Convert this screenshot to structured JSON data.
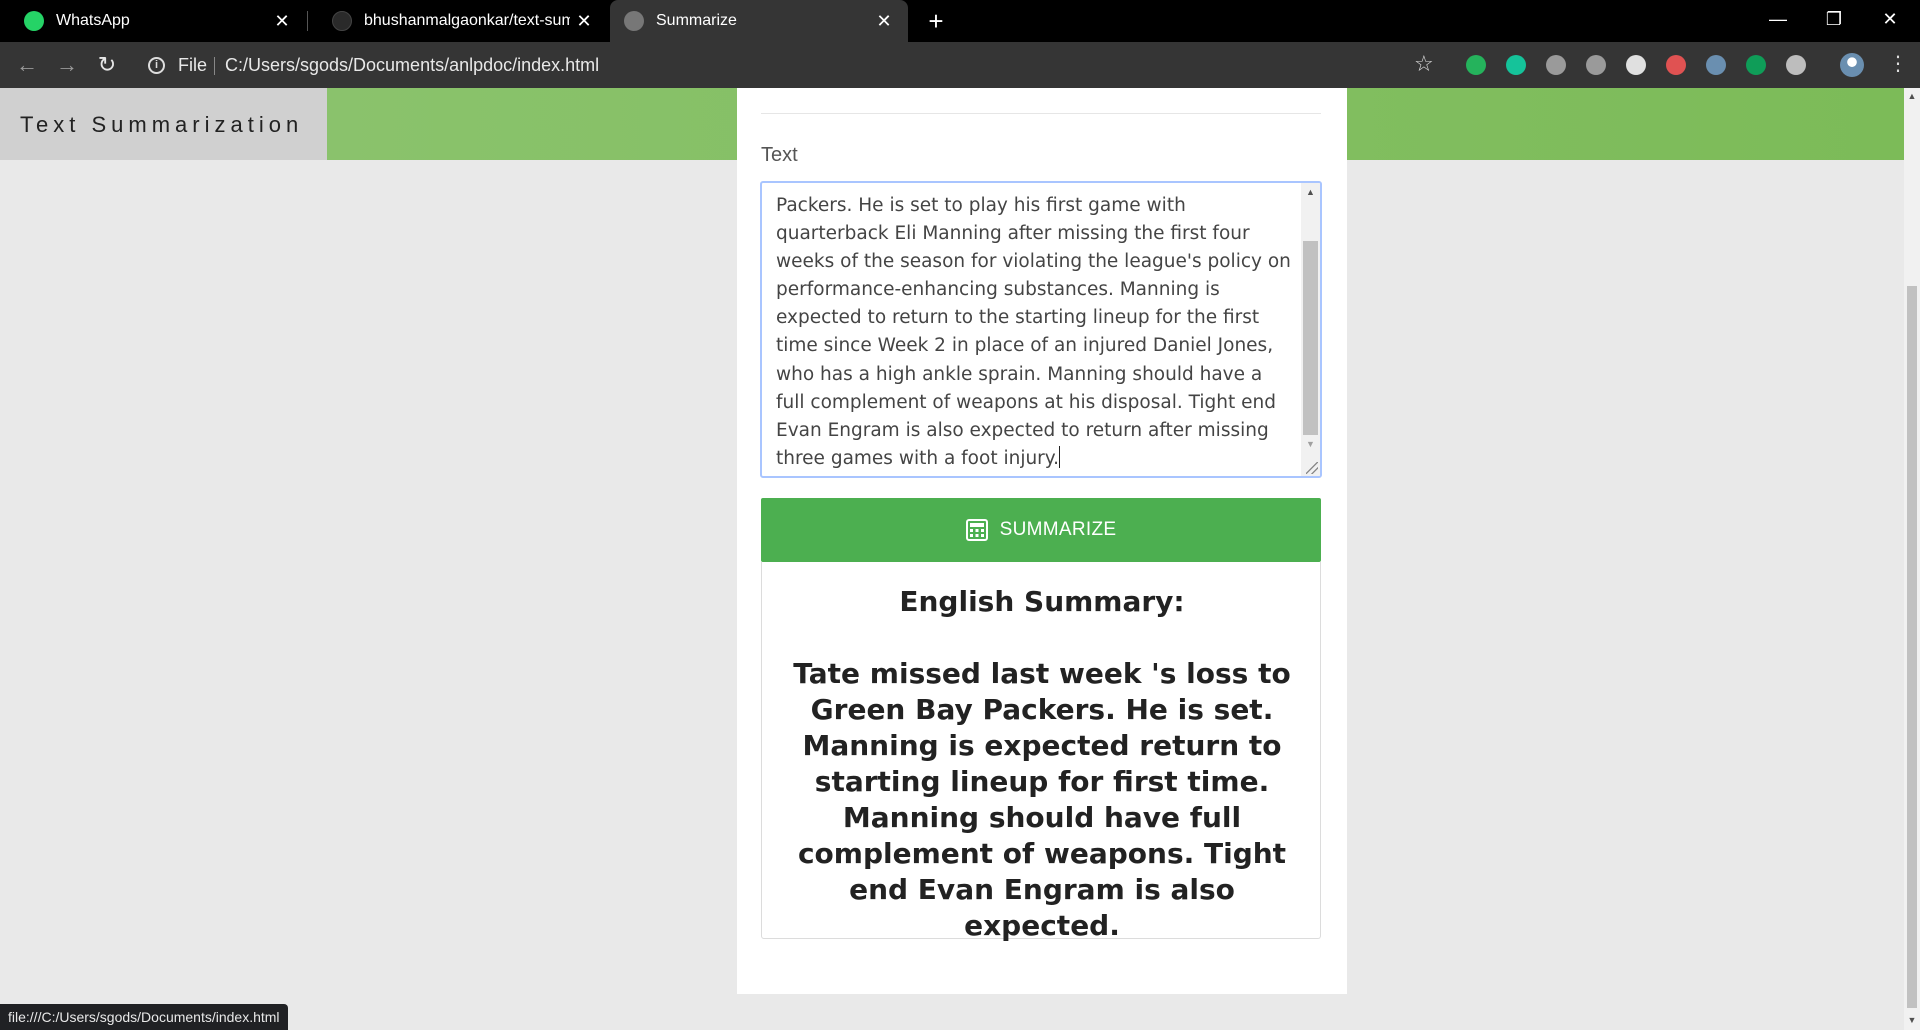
{
  "tabs": [
    {
      "title": "WhatsApp",
      "icon": "whatsapp-icon",
      "color": "#25d366"
    },
    {
      "title": "bhushanmalgaonkar/text-summa",
      "icon": "github-icon",
      "color": "#2a2a2a"
    },
    {
      "title": "Summarize",
      "icon": "globe-icon",
      "color": "#888888"
    }
  ],
  "address_bar": {
    "scheme_label": "File",
    "url": "C:/Users/sgods/Documents/anlpdoc/index.html"
  },
  "extensions": [
    {
      "name": "extension-green-icon",
      "color": "#25b35c"
    },
    {
      "name": "grammarly-icon",
      "color": "#15c39a"
    },
    {
      "name": "extension-p-icon",
      "color": "#9a9a9a"
    },
    {
      "name": "pdf-icon",
      "color": "#9a9a9a"
    },
    {
      "name": "extension-circle-icon",
      "color": "#e0e0e0"
    },
    {
      "name": "shield-extension-icon",
      "color": "#e05252"
    },
    {
      "name": "extension-window-icon",
      "color": "#6a8fb0"
    },
    {
      "name": "extension-chat-icon",
      "color": "#0f9d58"
    },
    {
      "name": "extension-bulb-icon",
      "color": "#bdbdbd"
    }
  ],
  "header": {
    "brand_title": "Text Summarization",
    "accent_color": "#7cbb58"
  },
  "form": {
    "text_label": "Text",
    "text_value": "Packers. He is set to play his first game with quarterback Eli Manning after missing the first four weeks of the season for violating the league's policy on performance-enhancing substances. Manning is expected to return to the starting lineup for the first time since Week 2 in place of an injured Daniel Jones, who has a high ankle sprain. Manning should have a full complement of weapons at his disposal. Tight end Evan Engram is also expected to return after missing three games with a foot injury.",
    "summarize_label": "SUMMARIZE",
    "button_color": "#4caf50"
  },
  "summary": {
    "heading": "English Summary:",
    "text": "Tate missed last week 's loss to Green Bay Packers. He is set. Manning is expected return to starting lineup for first time. Manning should have full complement of weapons. Tight end Evan Engram is also expected."
  },
  "status_bar": {
    "text": "file:///C:/Users/sgods/Documents/index.html"
  }
}
